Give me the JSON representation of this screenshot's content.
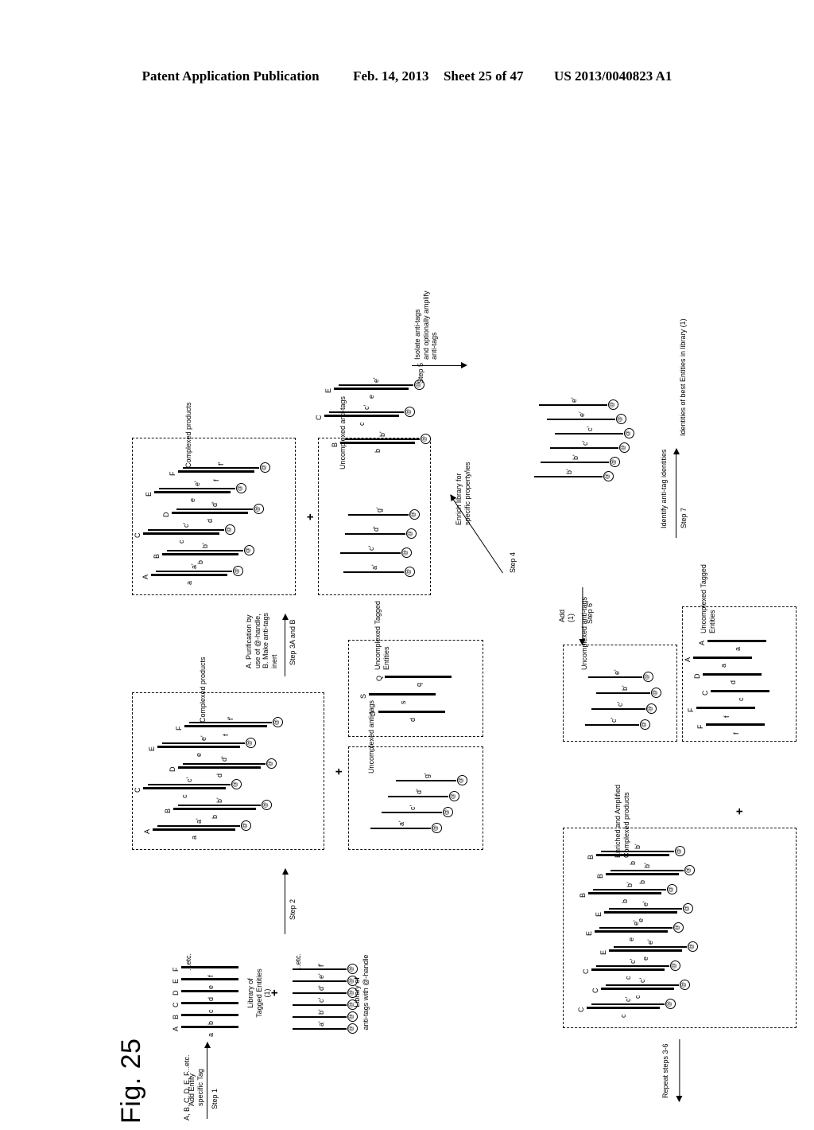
{
  "header": {
    "publication": "Patent Application Publication",
    "date": "Feb. 14, 2013",
    "sheet": "Sheet 25 of 47",
    "number": "US 2013/0040823 A1"
  },
  "figure": {
    "title": "Fig. 25",
    "start_label": "A, B, C, D, E, F...etc.",
    "etc": "...etc.",
    "plus": "+",
    "handle_glyph": "@"
  },
  "steps": {
    "step1": {
      "name": "Step 1",
      "caption": "Add Entity\nspecific Tag"
    },
    "step2": {
      "name": "Step 2",
      "caption": ""
    },
    "step3": {
      "name": "Step 3A and B",
      "caption": "A. Purification by\nuse of @-handle,\nB. Make anti-tags\ninert"
    },
    "step4": {
      "name": "Step 4",
      "caption": "Enrich library for\nspecific property/ies"
    },
    "step5": {
      "name": "Step 5",
      "caption": "Isolate anti-tags\nand optionally amplify\nanti-tags"
    },
    "step6": {
      "name": "Step 6",
      "caption": "Add\n(1)"
    },
    "step7": {
      "name": "Step 7",
      "caption": "Identify anti-tag identities"
    },
    "repeat": "Repeat steps 3-6"
  },
  "boxes": {
    "library_tagged": "Library of\nTagged Entities\n(1)",
    "library_antitags": "Library of\nanti-tags with @-handle",
    "complexed_products": "Complexed products",
    "uncomplexed_antitags": "Uncomplexed anti-tags",
    "uncomplexed_tagged": "Uncomplexed Tagged\nEntities",
    "enriched_products": "Enriched and Amplified\nComplexed products",
    "result": "Identities of best Entities in library (1)"
  },
  "library_tagged_entities": [
    {
      "tag": "a",
      "entity": "A"
    },
    {
      "tag": "b",
      "entity": "B"
    },
    {
      "tag": "c",
      "entity": "C"
    },
    {
      "tag": "d",
      "entity": "D"
    },
    {
      "tag": "e",
      "entity": "E"
    },
    {
      "tag": "f",
      "entity": "F"
    }
  ],
  "library_antitags": [
    "a'",
    "b'",
    "c'",
    "d'",
    "e'",
    "f'"
  ],
  "complexed_products_step2": [
    {
      "tag": "a",
      "entity": "A",
      "antitag": "a'"
    },
    {
      "tag": "b",
      "entity": "B",
      "antitag": "b'"
    },
    {
      "tag": "c",
      "entity": "C",
      "antitag": "c'"
    },
    {
      "tag": "d",
      "entity": "D",
      "antitag": "d'"
    },
    {
      "tag": "e",
      "entity": "E",
      "antitag": "e'"
    },
    {
      "tag": "f",
      "entity": "F",
      "antitag": "f'"
    }
  ],
  "uncomplexed_antitags_step3": [
    "a'",
    "c'",
    "d'",
    "g'"
  ],
  "uncomplexed_tagged_step3": [
    {
      "tag": "d",
      "entity": "D"
    },
    {
      "tag": "s",
      "entity": "S"
    },
    {
      "tag": "q",
      "entity": "Q"
    }
  ],
  "enriched_library_step4": [
    {
      "tag": "b",
      "entity": "B",
      "antitag": "b'"
    },
    {
      "tag": "c",
      "entity": "C",
      "antitag": "c'"
    },
    {
      "tag": "e",
      "entity": "E",
      "antitag": "e'"
    }
  ],
  "isolated_antitags_step5": [
    "b'",
    "b'",
    "c'",
    "c'",
    "e'",
    "e'"
  ],
  "enriched_amplified_products": [
    {
      "tag": "c",
      "entity": "C",
      "antitag": "c'"
    },
    {
      "tag": "c",
      "entity": "C",
      "antitag": "c'"
    },
    {
      "tag": "c",
      "entity": "C",
      "antitag": "c'"
    },
    {
      "tag": "e",
      "entity": "E",
      "antitag": "e'"
    },
    {
      "tag": "e",
      "entity": "E",
      "antitag": "e'"
    },
    {
      "tag": "e",
      "entity": "E",
      "antitag": "e'"
    },
    {
      "tag": "b",
      "entity": "B",
      "antitag": "b'"
    },
    {
      "tag": "b",
      "entity": "B",
      "antitag": "b'"
    },
    {
      "tag": "b",
      "entity": "B",
      "antitag": "b'"
    }
  ],
  "uncomplexed_antitags_step6": [
    "c'",
    "c'",
    "b'",
    "e'"
  ],
  "uncomplexed_tagged_step6": [
    {
      "tag": "f",
      "entity": "F"
    },
    {
      "tag": "f",
      "entity": "F"
    },
    {
      "tag": "c",
      "entity": "C"
    },
    {
      "tag": "d",
      "entity": "D"
    },
    {
      "tag": "a",
      "entity": "A"
    },
    {
      "tag": "a",
      "entity": "A"
    }
  ]
}
